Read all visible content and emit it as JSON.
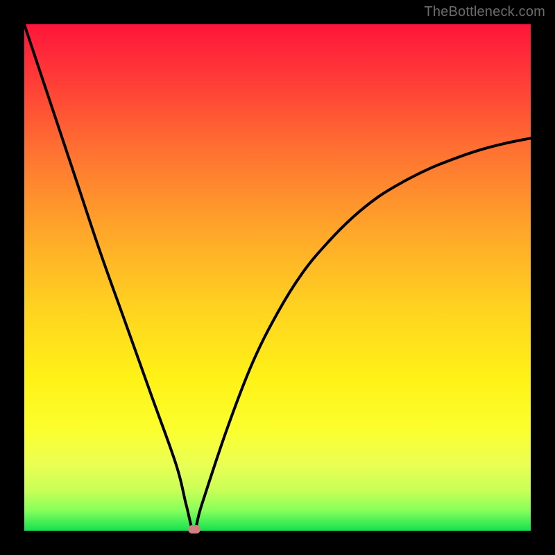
{
  "watermark": "TheBottleneck.com",
  "colors": {
    "frame": "#000000",
    "gradient_top": "#ff153b",
    "gradient_mid": "#fff217",
    "gradient_bottom": "#13e150",
    "curve": "#000000",
    "marker": "#d08080"
  },
  "chart_data": {
    "type": "line",
    "title": "",
    "xlabel": "",
    "ylabel": "",
    "xlim": [
      0,
      100
    ],
    "ylim": [
      0,
      100
    ],
    "x": [
      0,
      5,
      10,
      15,
      20,
      25,
      30,
      32,
      33.5,
      35,
      40,
      45,
      50,
      55,
      60,
      65,
      70,
      75,
      80,
      85,
      90,
      95,
      100
    ],
    "y": [
      100,
      85,
      70,
      55,
      41,
      27,
      13,
      5,
      0,
      5,
      20,
      33,
      43,
      51,
      57,
      62,
      66,
      69,
      71.5,
      73.5,
      75.2,
      76.5,
      77.5
    ],
    "annotations": [
      {
        "type": "marker",
        "x": 33.5,
        "y": 0,
        "shape": "rounded-rect",
        "color": "#d08080"
      }
    ]
  }
}
